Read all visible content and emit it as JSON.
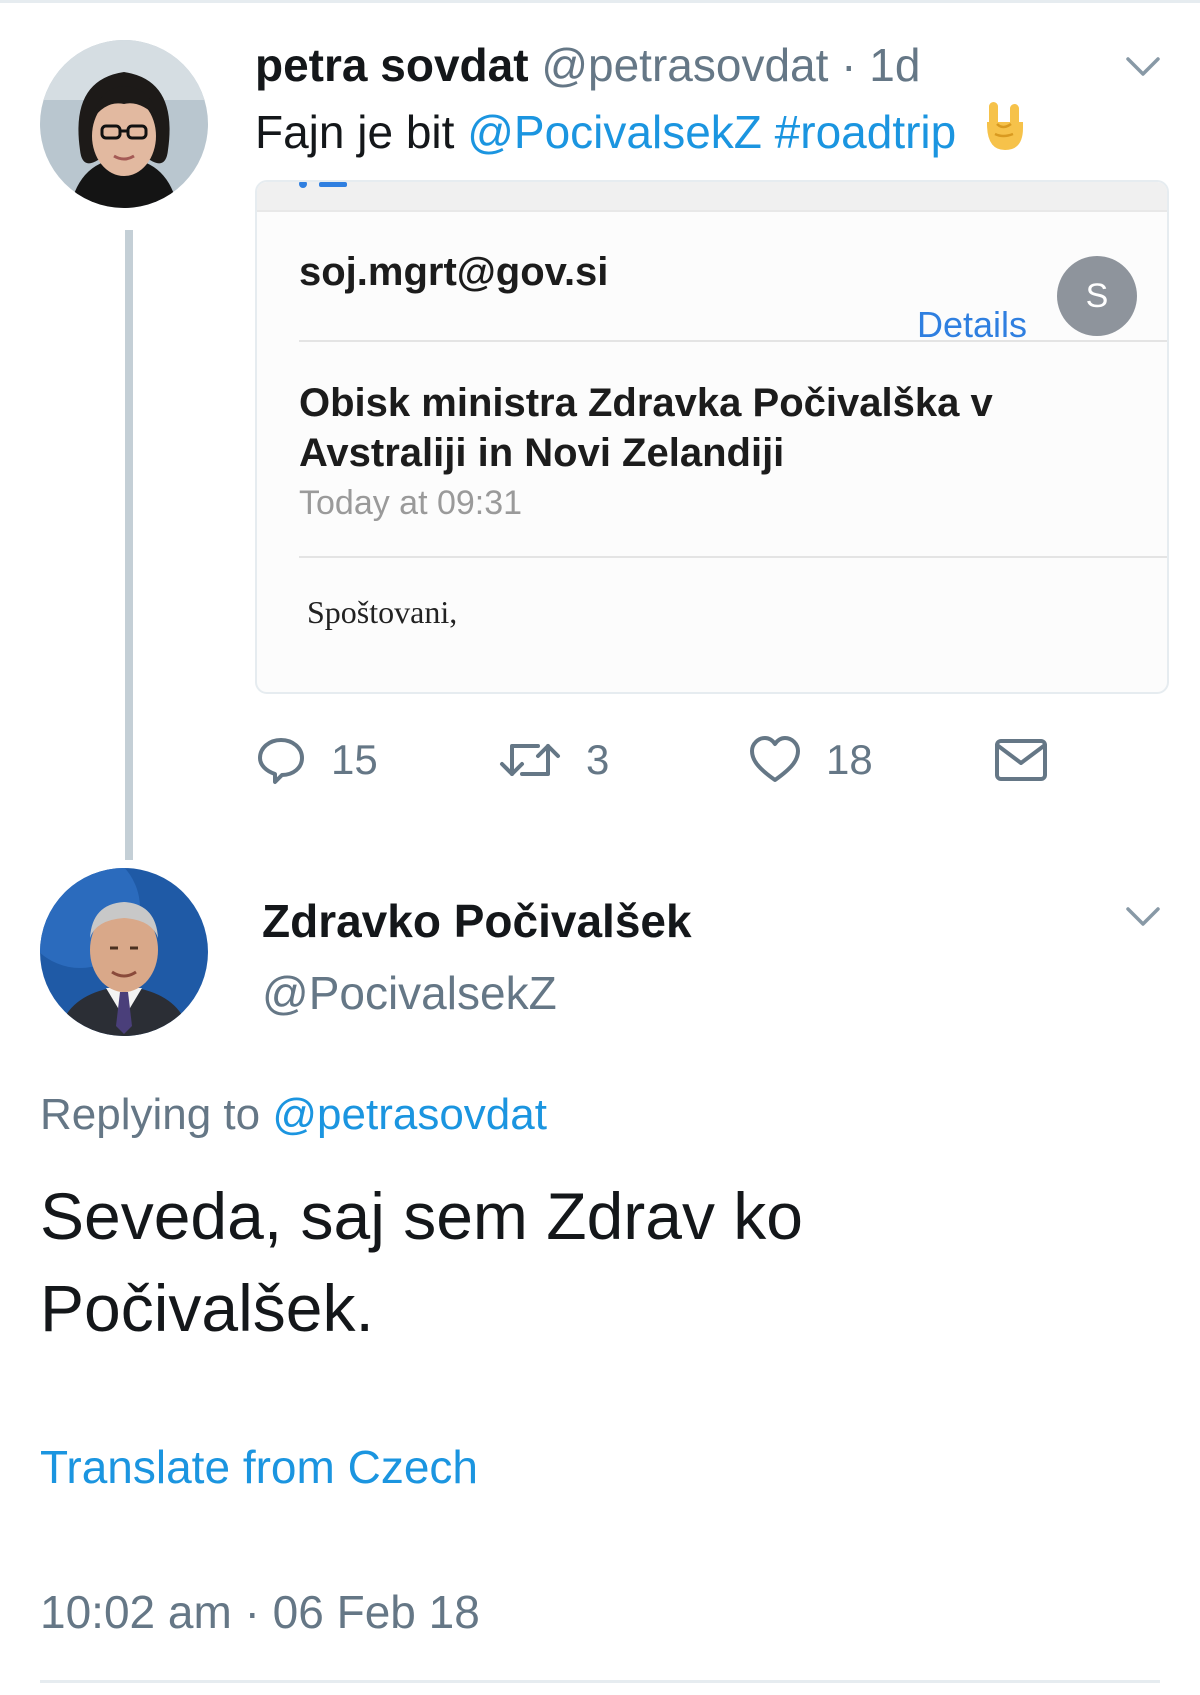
{
  "tweet1": {
    "name": "petra sovdat",
    "handle": "@petrasovdat",
    "separator": "·",
    "time": "1d",
    "text_prefix": "Fajn je bit",
    "mention": "@PocivalsekZ",
    "hashtag": "#roadtrip",
    "emoji_icon": "rock-on-hand",
    "email_card": {
      "from": "soj.mgrt@gov.si",
      "details_label": "Details",
      "sender_initial": "S",
      "subject": "Obisk ministra Zdravka Počivalška v Avstraliji in Novi Zelandiji",
      "date": "Today at 09:31",
      "greeting": "Spoštovani,"
    },
    "actions": {
      "reply_count": "15",
      "retweet_count": "3",
      "like_count": "18"
    }
  },
  "tweet2": {
    "name": "Zdravko Počivalšek",
    "handle": "@PocivalsekZ",
    "replying_prefix": "Replying to",
    "replying_to": "@petrasovdat",
    "text": "Seveda, saj sem Zdrav ko Počivalšek.",
    "translate_label": "Translate from Czech",
    "timestamp": "10:02 am · 06 Feb 18"
  },
  "colors": {
    "link": "#1b95e0",
    "secondary_text": "#657786",
    "thread_line": "#c4cfd6",
    "email_details": "#2f7fe0"
  }
}
